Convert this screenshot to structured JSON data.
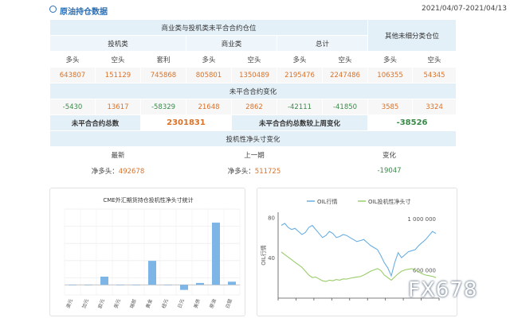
{
  "header": {
    "title": "原油持仓数据",
    "date_range": "2021/04/07-2021/04/13"
  },
  "table": {
    "group_title": "商业类与投机类未平合合约仓位",
    "other_title": "其他未细分类仓位",
    "spec_label": "投机类",
    "comm_label": "商业类",
    "total_label": "总计",
    "col_long": "多头",
    "col_short": "空头",
    "col_spread": "套利",
    "row1": [
      "643807",
      "151129",
      "745868",
      "805801",
      "1350489",
      "2195476",
      "2247486",
      "106355",
      "54345"
    ],
    "change_title": "未平合合约变化",
    "row2": [
      "-5430",
      "13617",
      "-58329",
      "21648",
      "2862",
      "-42111",
      "-41850",
      "3585",
      "3324"
    ],
    "oi_total_label": "未平合合约总数",
    "oi_total_value": "2301831",
    "oi_change_label": "未平合合约总数较上周变化",
    "oi_change_value": "-38526",
    "net_title": "投机性净头寸变化",
    "latest_label": "最新",
    "prev_label": "上一期",
    "change_label": "变化",
    "net_prefix": "净多头：",
    "latest_value": "492678",
    "prev_value": "511725",
    "change_value": "-19047"
  },
  "chart_data": [
    {
      "type": "bar",
      "title": "CME外汇期货持仓投机性净头寸统计",
      "categories": [
        "澳元",
        "加元",
        "欧元",
        "英元",
        "瑞郎",
        "黄金",
        "纽元",
        "日元",
        "美债",
        "原油",
        "白银"
      ],
      "values": [
        0,
        0,
        65000,
        0,
        0,
        190000,
        0,
        -40000,
        15000,
        492678,
        25000
      ],
      "ylim": [
        -80000,
        600000
      ],
      "color": "#7cb5e6"
    },
    {
      "type": "line",
      "series": [
        {
          "name": "OIL行情",
          "color": "#6aaee0",
          "values": [
            72,
            74,
            70,
            68,
            69,
            66,
            63,
            65,
            70,
            72,
            68,
            64,
            60,
            62,
            66,
            64,
            60,
            61,
            63,
            62,
            60,
            58,
            56,
            57,
            58,
            55,
            52,
            50,
            48,
            42,
            35,
            30,
            22,
            35,
            45,
            40,
            43,
            46,
            47,
            48,
            52,
            55,
            58,
            62,
            66,
            64
          ]
        },
        {
          "name": "OIL投机性净头寸",
          "color": "#9acd6a",
          "values": [
            740000,
            720000,
            700000,
            680000,
            660000,
            640000,
            620000,
            590000,
            560000,
            540000,
            545000,
            530000,
            515000,
            510000,
            520000,
            515000,
            525000,
            520000,
            530000,
            528000,
            535000,
            540000,
            545000,
            548000,
            560000,
            575000,
            590000,
            600000,
            610000,
            595000,
            560000,
            540000,
            520000,
            545000,
            570000,
            590000,
            600000,
            605000,
            610000,
            600000,
            585000,
            570000,
            560000,
            555000,
            550000,
            540000
          ]
        }
      ],
      "ylabel": "OIL行情",
      "left_ticks": [
        "80",
        "40"
      ],
      "right_ticks": [
        "1 000 000",
        "600 000"
      ],
      "ylim_left": [
        0,
        85
      ],
      "ylim_right": [
        380000,
        1050000
      ]
    }
  ],
  "watermark": "FX678"
}
